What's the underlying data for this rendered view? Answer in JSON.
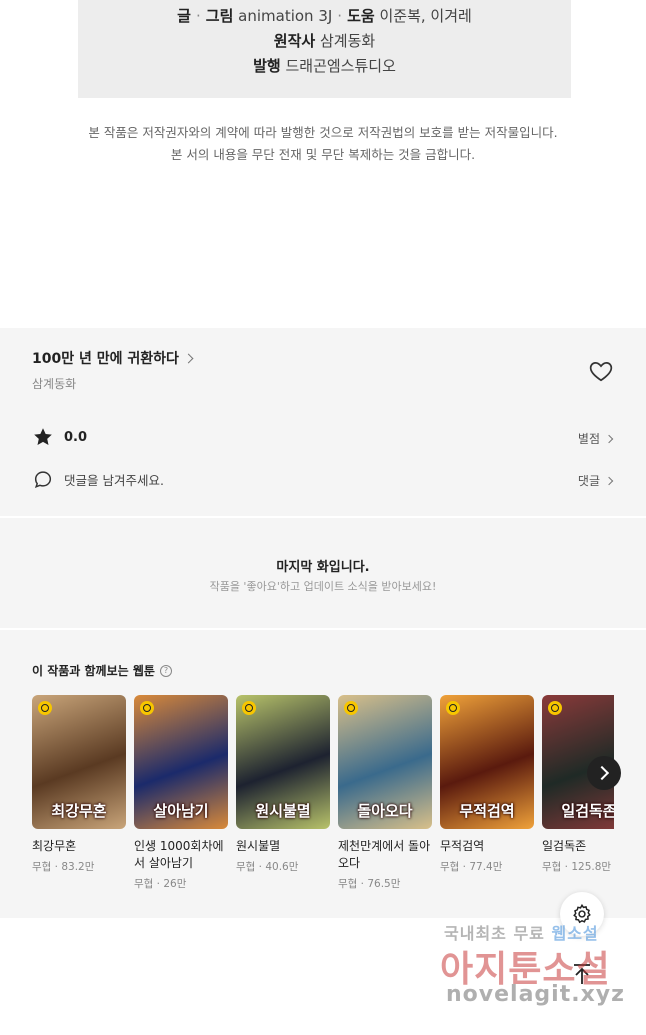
{
  "credits": {
    "line1": {
      "label_writer": "글",
      "sep": "·",
      "label_art": "그림",
      "value_art": "animation 3J",
      "label_assist": "도움",
      "value_assist": "이준복, 이겨레"
    },
    "line2": {
      "label": "원작사",
      "value": "삼계동화"
    },
    "line3": {
      "label": "발행",
      "value": "드래곤엠스튜디오"
    }
  },
  "copyright": {
    "line1": "본 작품은 저작권자와의 계약에 따라 발행한 것으로 저작권법의 보호를 받는 저작물입니다.",
    "line2": "본 서의 내용을 무단 전재 및 무단 복제하는 것을 금합니다."
  },
  "series": {
    "title": "100만 년 만에 귀환하다",
    "author": "삼계동화",
    "rating": "0.0",
    "rate_link": "별점",
    "comment_placeholder": "댓글을 남겨주세요.",
    "comment_link": "댓글"
  },
  "last_episode": {
    "title": "마지막 화입니다.",
    "subtitle": "작품을 '좋아요'하고 업데이트 소식을 받아보세요!"
  },
  "recommend": {
    "heading": "이 작품과 함께보는 웹툰",
    "help": "?",
    "items": [
      {
        "name": "최강무혼",
        "meta": "무협 · 83.2만",
        "thumb_text": "최강무혼",
        "bg": "#5a3a22",
        "bg2": "#c9a57a"
      },
      {
        "name": "인생 1000회차에서 살아남기",
        "meta": "무협 · 26만",
        "thumb_text": "살아남기",
        "bg": "#1b2a6b",
        "bg2": "#d98a3a"
      },
      {
        "name": "원시불멸",
        "meta": "무협 · 40.6만",
        "thumb_text": "원시불멸",
        "bg": "#1d2230",
        "bg2": "#b8c36a"
      },
      {
        "name": "제천만계에서 돌아오다",
        "meta": "무협 · 76.5만",
        "thumb_text": "돌아오다",
        "bg": "#3a6a8c",
        "bg2": "#d9c08a"
      },
      {
        "name": "무적검역",
        "meta": "무협 · 77.4만",
        "thumb_text": "무적검역",
        "bg": "#5a1a0e",
        "bg2": "#f0a23a"
      },
      {
        "name": "일검독존",
        "meta": "무협 · 125.8만",
        "thumb_text": "일검독존",
        "bg": "#1f2a26",
        "bg2": "#8a3a3a"
      }
    ]
  },
  "watermark": {
    "line1_a": "국내최초 무료",
    "line1_b": "웹소설",
    "line2": "아지툰소설",
    "line3": "novelagit.xyz"
  }
}
